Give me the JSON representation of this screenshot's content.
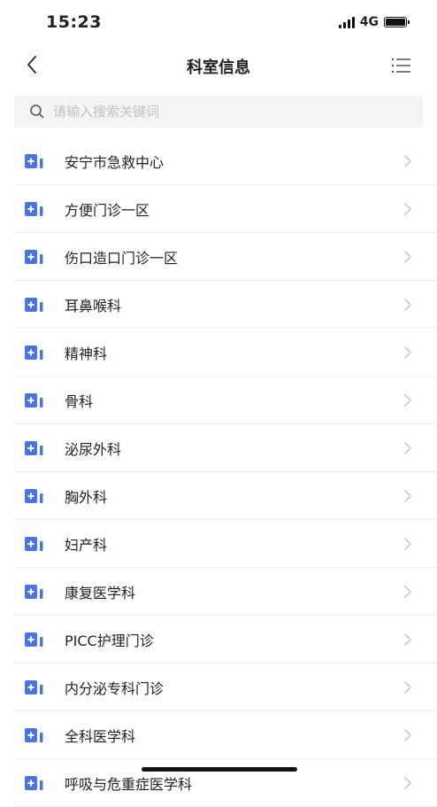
{
  "status_bar": {
    "time": "15:23",
    "network": "4G"
  },
  "header": {
    "title": "科室信息"
  },
  "search": {
    "placeholder": "请输入搜索关键词",
    "value": ""
  },
  "departments": [
    {
      "label": "安宁市急救中心"
    },
    {
      "label": "方便门诊一区"
    },
    {
      "label": "伤口造口门诊一区"
    },
    {
      "label": "耳鼻喉科"
    },
    {
      "label": "精神科"
    },
    {
      "label": "骨科"
    },
    {
      "label": "泌尿外科"
    },
    {
      "label": "胸外科"
    },
    {
      "label": "妇产科"
    },
    {
      "label": "康复医学科"
    },
    {
      "label": "PICC护理门诊"
    },
    {
      "label": "内分泌专科门诊"
    },
    {
      "label": "全科医学科"
    },
    {
      "label": "呼吸与危重症医学科"
    }
  ],
  "colors": {
    "accent": "#4a74e0",
    "chevron": "#c4c4c4",
    "divider": "#eeeeee",
    "search_bg": "#f3f4f6"
  }
}
